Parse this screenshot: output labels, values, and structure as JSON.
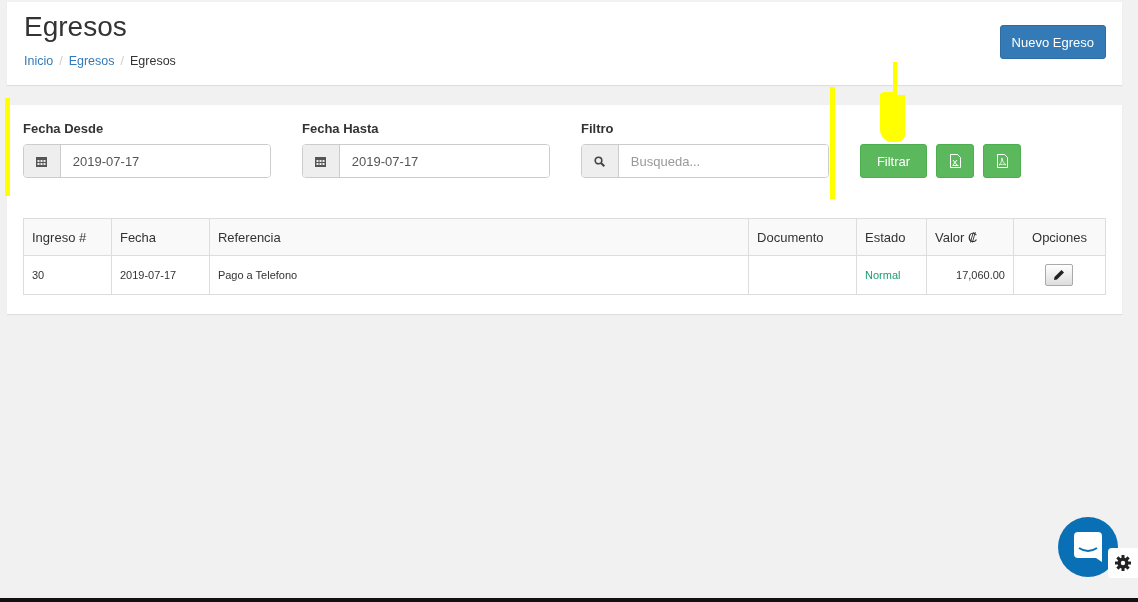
{
  "header": {
    "title": "Egresos",
    "breadcrumb": [
      {
        "label": "Inicio",
        "link": true
      },
      {
        "label": "Egresos",
        "link": true
      },
      {
        "label": "Egresos",
        "link": false
      }
    ],
    "breadcrumb_separator": "/",
    "new_button": "Nuevo Egreso"
  },
  "filters": {
    "date_from": {
      "label": "Fecha Desde",
      "value": "2019-07-17"
    },
    "date_to": {
      "label": "Fecha Hasta",
      "value": "2019-07-17"
    },
    "search": {
      "label": "Filtro",
      "placeholder": "Busqueda..."
    },
    "filter_button": "Filtrar"
  },
  "table": {
    "columns": [
      "Ingreso #",
      "Fecha",
      "Referencia",
      "Documento",
      "Estado",
      "Valor ₡",
      "Opciones"
    ],
    "rows": [
      {
        "cells": [
          "30",
          "2019-07-17",
          "Pago a Telefono",
          "",
          "Normal",
          "17,060.00"
        ]
      }
    ]
  }
}
